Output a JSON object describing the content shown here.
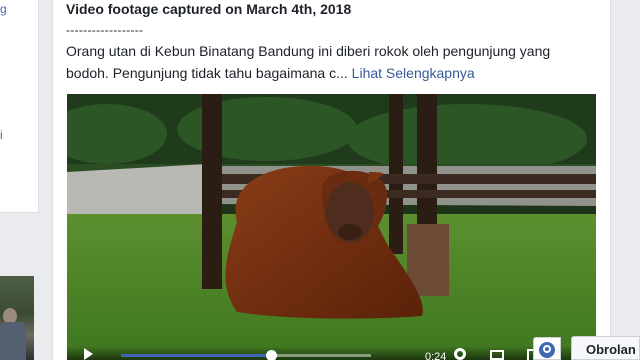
{
  "sidebar": {
    "fragments": [
      "g",
      "i"
    ]
  },
  "post": {
    "title_line": "Video footage captured on March 4th, 2018",
    "separator": "------------------",
    "body_text": "Orang utan di Kebun Binatang Bandung ini diberi rokok oleh pengunjung yang bodoh. Pengunjung tidak tahu bagaimana c...",
    "see_more_label": "Lihat Selengkapnya"
  },
  "video_player": {
    "current_time": "0:24",
    "progress_fraction": 0.6
  },
  "chat": {
    "label": "Obrolan"
  },
  "colors": {
    "link": "#385898",
    "fb_blue": "#4267b2",
    "page_bg": "#e9ebee",
    "card_bg": "#ffffff",
    "text": "#1d2129"
  },
  "icons": [
    "play-icon",
    "settings-gear-icon",
    "picture-in-picture-icon",
    "fullscreen-icon",
    "globe-icon"
  ]
}
